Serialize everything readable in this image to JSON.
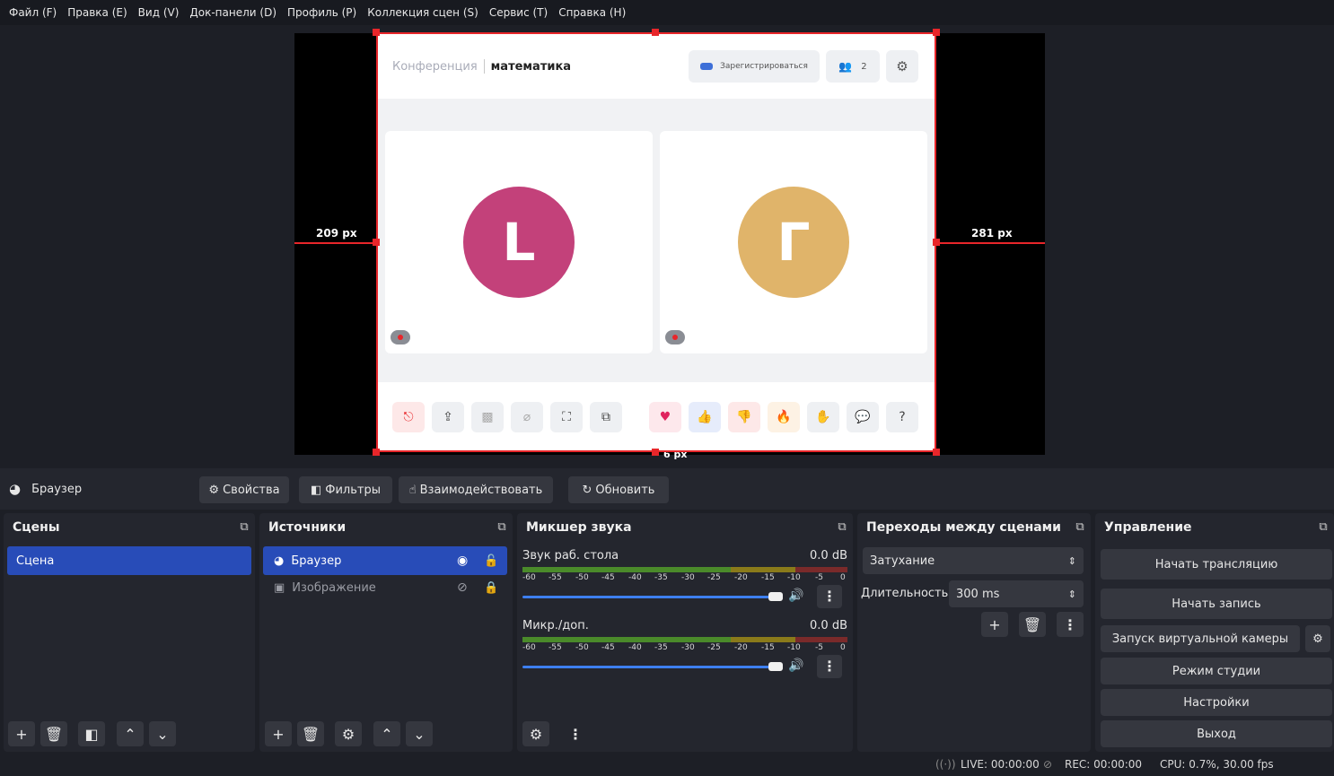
{
  "menu": [
    "Файл (F)",
    "Правка (E)",
    "Вид (V)",
    "Док-панели (D)",
    "Профиль (P)",
    "Коллекция сцен (S)",
    "Сервис (T)",
    "Справка (H)"
  ],
  "preview": {
    "guide_left": "209 px",
    "guide_right": "281 px",
    "guide_bottom": "6 px"
  },
  "conference": {
    "title_muted": "Конференция",
    "title_bold": "математика",
    "register_label": "Зарегистрироваться",
    "participants_count": "2",
    "tiles": [
      {
        "initial": "L",
        "color": "#c3417a"
      },
      {
        "initial": "Г",
        "color": "#e0b46a"
      }
    ]
  },
  "source_toolbar": {
    "source_name": "Браузер",
    "properties": "Свойства",
    "filters": "Фильтры",
    "interact": "Взаимодействовать",
    "refresh": "Обновить"
  },
  "scenes": {
    "title": "Сцены",
    "items": [
      "Сцена"
    ]
  },
  "sources": {
    "title": "Источники",
    "items": [
      {
        "name": "Браузер",
        "visible": true,
        "locked": false
      },
      {
        "name": "Изображение",
        "visible": false,
        "locked": true
      }
    ]
  },
  "mixer": {
    "title": "Микшер звука",
    "channels": [
      {
        "name": "Звук раб. стола",
        "level": "0.0 dB",
        "volume": 1.0
      },
      {
        "name": "Микр./доп.",
        "level": "0.0 dB",
        "volume": 1.0
      }
    ],
    "ticks": [
      "-60",
      "-55",
      "-50",
      "-45",
      "-40",
      "-35",
      "-30",
      "-25",
      "-20",
      "-15",
      "-10",
      "-5",
      "0"
    ]
  },
  "transitions": {
    "title": "Переходы между сценами",
    "selected": "Затухание",
    "duration_label": "Длительность",
    "duration_value": "300 ms"
  },
  "controls": {
    "title": "Управление",
    "start_stream": "Начать трансляцию",
    "start_record": "Начать запись",
    "virtual_cam": "Запуск виртуальной камеры",
    "studio_mode": "Режим студии",
    "settings": "Настройки",
    "exit": "Выход"
  },
  "status": {
    "live": "LIVE: 00:00:00",
    "rec": "REC: 00:00:00",
    "cpu": "CPU: 0.7%, 30.00 fps"
  },
  "colors": {
    "accent": "#284cb8",
    "frame": "#e8262a"
  }
}
